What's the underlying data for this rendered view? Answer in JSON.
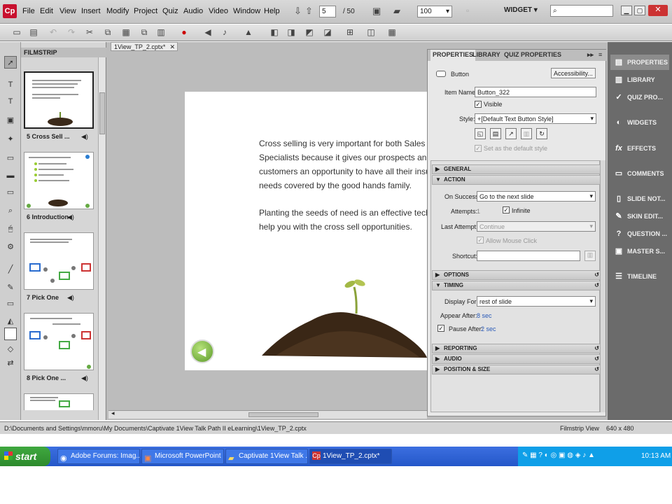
{
  "menubar": {
    "logo": "Cp",
    "items": [
      "File",
      "Edit",
      "View",
      "Insert",
      "Modify",
      "Project",
      "Quiz",
      "Audio",
      "Video",
      "Window",
      "Help"
    ],
    "slide_current": "5",
    "slide_total": "/ 50",
    "zoom": "100",
    "workspace": "WIDGET"
  },
  "filmstrip": {
    "title": "FILMSTRIP",
    "thumbs": [
      {
        "label": "5 Cross Sell ..."
      },
      {
        "label": "6 Introduction"
      },
      {
        "label": "7 Pick One"
      },
      {
        "label": "8 Pick One ..."
      },
      {
        "label": ""
      }
    ]
  },
  "document": {
    "tab": "1View_TP_2.cptx*",
    "para1": [
      "Cross selling is very important for both Sales and",
      "Specialists because it gives our prospects and ex",
      "customers an opportunity to have all their insura",
      "needs covered by the good hands family."
    ],
    "para2": [
      "Planting the seeds of need is an effective techni",
      "help you with the cross sell opportunities."
    ]
  },
  "properties": {
    "tabs": [
      "PROPERTIES",
      "LIBRARY",
      "QUIZ PROPERTIES"
    ],
    "object_type": "Button",
    "accessibility_label": "Accessibility...",
    "item_name_label": "Item Name:",
    "item_name_value": "Button_322",
    "visible_label": "Visible",
    "style_label": "Style:",
    "style_value": "+[Default Text Button Style]",
    "default_style_label": "Set as the default style",
    "sections": {
      "general": "GENERAL",
      "action": "ACTION",
      "options": "OPTIONS",
      "timing": "TIMING",
      "reporting": "REPORTING",
      "audio": "AUDIO",
      "position": "POSITION & SIZE"
    },
    "action": {
      "on_success_label": "On Success:",
      "on_success_value": "Go to the next slide",
      "attempts_label": "Attempts:",
      "attempts_value": "1",
      "infinite_label": "Infinite",
      "last_attempt_label": "Last Attempt:",
      "last_attempt_value": "Continue",
      "allow_mouse_label": "Allow Mouse Click",
      "shortcut_label": "Shortcut:"
    },
    "timing": {
      "display_for_label": "Display For:",
      "display_for_value": "rest of slide",
      "appear_after_label": "Appear After:",
      "appear_after_value": "8 sec",
      "pause_after_label": "Pause After:",
      "pause_after_value": "2 sec"
    }
  },
  "rightpanel": {
    "items": [
      "PROPERTIES",
      "LIBRARY",
      "QUIZ PRO...",
      "WIDGETS",
      "EFFECTS",
      "COMMENTS",
      "SLIDE NOT...",
      "SKIN EDIT...",
      "QUESTION ...",
      "MASTER S...",
      "TIMELINE"
    ]
  },
  "status": {
    "path": "D:\\Documents and Settings\\mmoru\\My Documents\\Captivate 1View Talk Path II eLearning\\1View_TP_2.cptx",
    "view": "Filmstrip View",
    "size": "640 x 480"
  },
  "taskbar": {
    "start": "start",
    "tasks": [
      "Adobe Forums: Imag...",
      "Microsoft PowerPoint ...",
      "Captivate 1View Talk ...",
      "1View_TP_2.cptx*"
    ],
    "clock": "10:13 AM"
  }
}
